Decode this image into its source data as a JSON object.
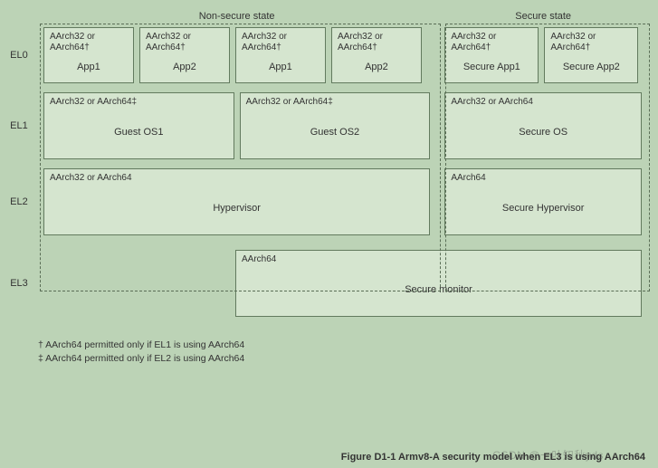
{
  "states": {
    "nonsecure": "Non-secure state",
    "secure": "Secure state"
  },
  "levels": {
    "el0": "EL0",
    "el1": "EL1",
    "el2": "EL2",
    "el3": "EL3"
  },
  "arch": {
    "a32or64dag": "AArch32 or AArch64†",
    "a32or64ddag": "AArch32 or AArch64‡",
    "a32or64": "AArch32 or AArch64",
    "a64": "AArch64"
  },
  "el0": {
    "ns": [
      {
        "arch": "AArch32 or AArch64†",
        "label": "App1"
      },
      {
        "arch": "AArch32 or AArch64†",
        "label": "App2"
      },
      {
        "arch": "AArch32 or AArch64†",
        "label": "App1"
      },
      {
        "arch": "AArch32 or AArch64†",
        "label": "App2"
      }
    ],
    "s": [
      {
        "arch": "AArch32 or AArch64†",
        "label": "Secure App1"
      },
      {
        "arch": "AArch32 or AArch64†",
        "label": "Secure App2"
      }
    ]
  },
  "el1": {
    "ns": [
      {
        "arch": "AArch32 or AArch64‡",
        "label": "Guest OS1"
      },
      {
        "arch": "AArch32 or AArch64‡",
        "label": "Guest OS2"
      }
    ],
    "s": [
      {
        "arch": "AArch32 or AArch64",
        "label": "Secure OS"
      }
    ]
  },
  "el2": {
    "ns": [
      {
        "arch": "AArch32 or AArch64",
        "label": "Hypervisor"
      }
    ],
    "s": [
      {
        "arch": "AArch64",
        "label": "Secure Hypervisor"
      }
    ]
  },
  "el3": {
    "arch": "AArch64",
    "label": "Secure monitor"
  },
  "notes": {
    "n1": "† AArch64 permitted only if EL1 is using AArch64",
    "n2": "‡ AArch64 permitted only if EL2 is using AArch64"
  },
  "caption": "Figure D1-1 Armv8-A security model when EL3 is using AArch64",
  "watermark": "CSDN @一叶知秋yds"
}
